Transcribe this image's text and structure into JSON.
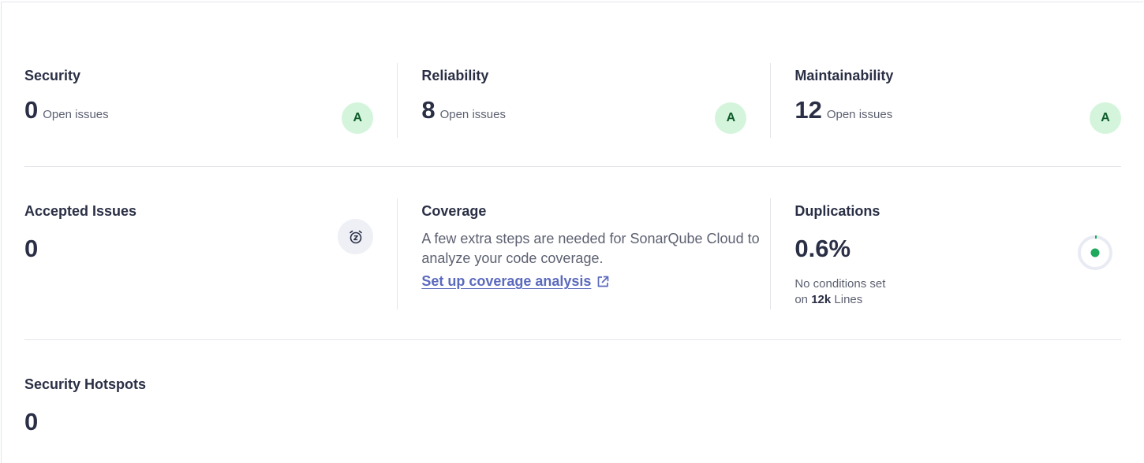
{
  "row1": {
    "security": {
      "title": "Security",
      "value": "0",
      "suffix": "Open issues",
      "rating": "A"
    },
    "reliability": {
      "title": "Reliability",
      "value": "8",
      "suffix": "Open issues",
      "rating": "A"
    },
    "maintainability": {
      "title": "Maintainability",
      "value": "12",
      "suffix": "Open issues",
      "rating": "A"
    }
  },
  "row2": {
    "accepted": {
      "title": "Accepted Issues",
      "value": "0",
      "icon": "snooze-clock-icon"
    },
    "coverage": {
      "title": "Coverage",
      "description": "A few extra steps are needed for SonarQube Cloud to analyze your code coverage.",
      "link_label": "Set up coverage analysis",
      "link_icon": "external-link-icon"
    },
    "duplications": {
      "title": "Duplications",
      "value": "0.6%",
      "note_line1": "No conditions set",
      "note_prefix": "on",
      "note_bold": "12k",
      "note_suffix": "Lines",
      "ratio_percent": 0.6,
      "colors": {
        "ring_bg": "#e8ebf3",
        "ring_fill": "#1fa95c",
        "dot": "#1fa95c"
      }
    }
  },
  "row3": {
    "hotspots": {
      "title": "Security Hotspots",
      "value": "0"
    }
  },
  "colors": {
    "rating_bg": "#d4f5dc",
    "rating_text": "#0f5c2b",
    "link": "#5b6abe",
    "divider": "#e3e5ea"
  }
}
